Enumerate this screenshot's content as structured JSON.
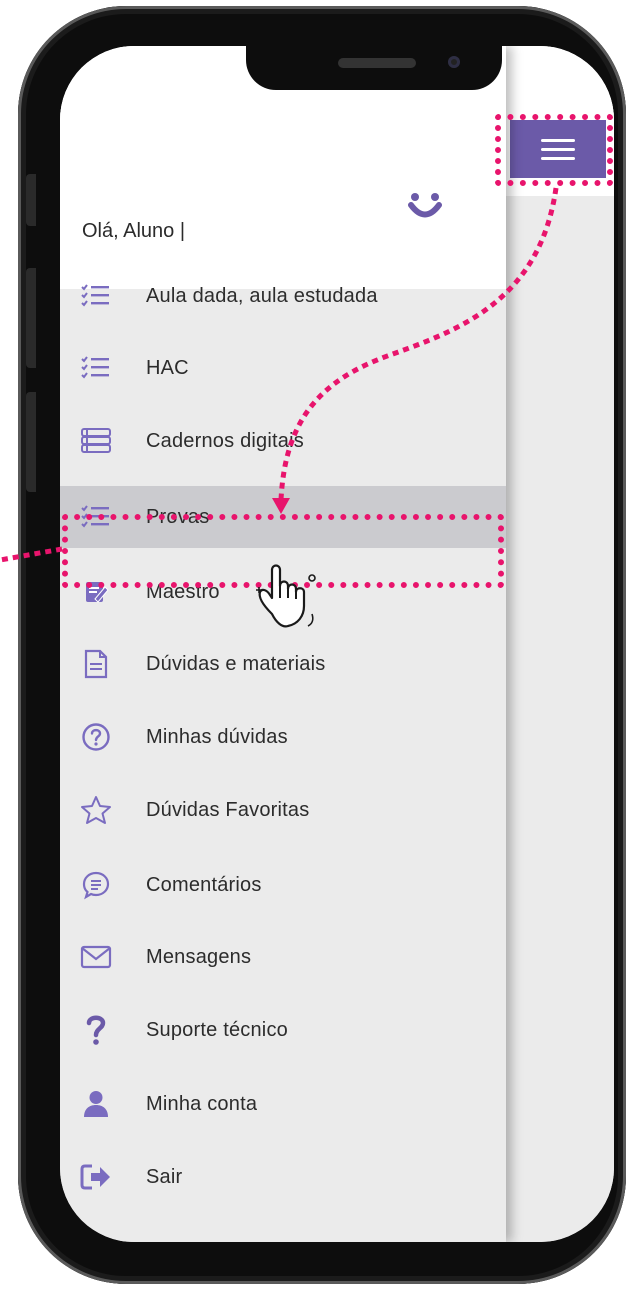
{
  "header": {
    "greeting": "Olá, Aluno |"
  },
  "menu_button": {
    "icon": "hamburger-icon"
  },
  "menu": [
    {
      "key": "aula",
      "label": "Aula dada, aula estudada",
      "icon": "checklist-icon"
    },
    {
      "key": "hac",
      "label": "HAC",
      "icon": "checklist-icon"
    },
    {
      "key": "cadernos",
      "label": "Cadernos digitais",
      "icon": "books-icon"
    },
    {
      "key": "provas",
      "label": "Provas",
      "icon": "checklist-icon",
      "active": true
    },
    {
      "key": "maestro",
      "label": "Maestro",
      "icon": "edit-note-icon"
    },
    {
      "key": "duvidas-materiais",
      "label": "Dúvidas e materiais",
      "icon": "document-icon"
    },
    {
      "key": "minhas-duvidas",
      "label": "Minhas dúvidas",
      "icon": "question-circle-icon"
    },
    {
      "key": "favoritas",
      "label": "Dúvidas Favoritas",
      "icon": "star-icon"
    },
    {
      "key": "comentarios",
      "label": "Comentários",
      "icon": "chat-bubble-icon"
    },
    {
      "key": "mensagens",
      "label": "Mensagens",
      "icon": "envelope-icon"
    },
    {
      "key": "suporte",
      "label": "Suporte técnico",
      "icon": "question-mark-icon"
    },
    {
      "key": "conta",
      "label": "Minha conta",
      "icon": "user-icon"
    },
    {
      "key": "sair",
      "label": "Sair",
      "icon": "logout-icon"
    }
  ],
  "colors": {
    "accent": "#6b5aa8",
    "highlight": "#e8146c",
    "active_row": "#cbcbcf"
  }
}
